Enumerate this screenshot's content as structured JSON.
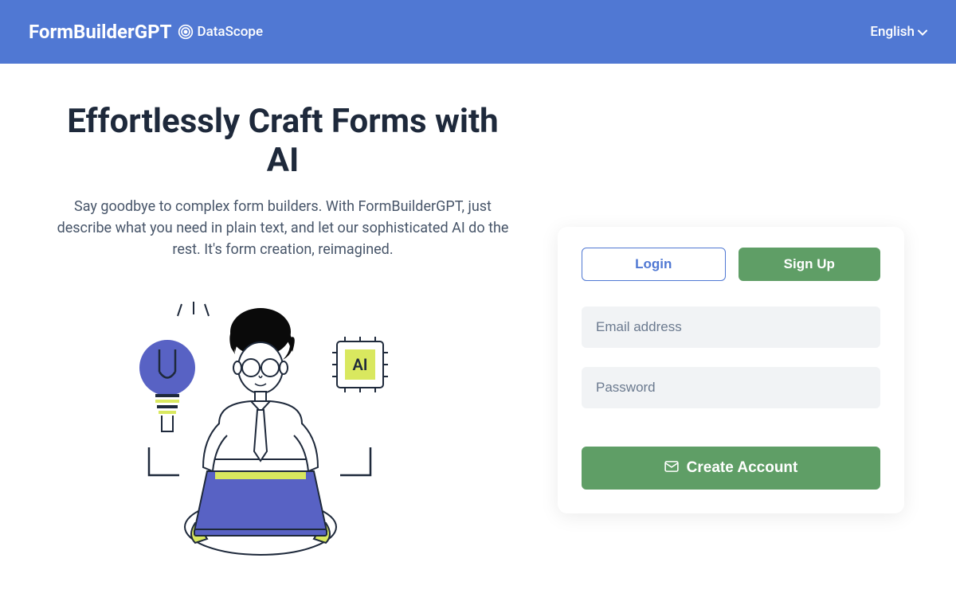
{
  "header": {
    "logo_primary": "FormBuilderGPT",
    "logo_secondary": "DataScope",
    "language": "English"
  },
  "hero": {
    "title": "Effortlessly Craft Forms with AI",
    "description": "Say goodbye to complex form builders. With FormBuilderGPT, just describe what you need in plain text, and let our sophisticated AI do the rest. It's form creation, reimagined."
  },
  "auth": {
    "tabs": {
      "login": "Login",
      "signup": "Sign Up"
    },
    "email_placeholder": "Email address",
    "password_placeholder": "Password",
    "submit_label": "Create Account"
  },
  "colors": {
    "primary_blue": "#5078d3",
    "green": "#5f9e66",
    "text_dark": "#1e293b",
    "text_muted": "#475569"
  }
}
